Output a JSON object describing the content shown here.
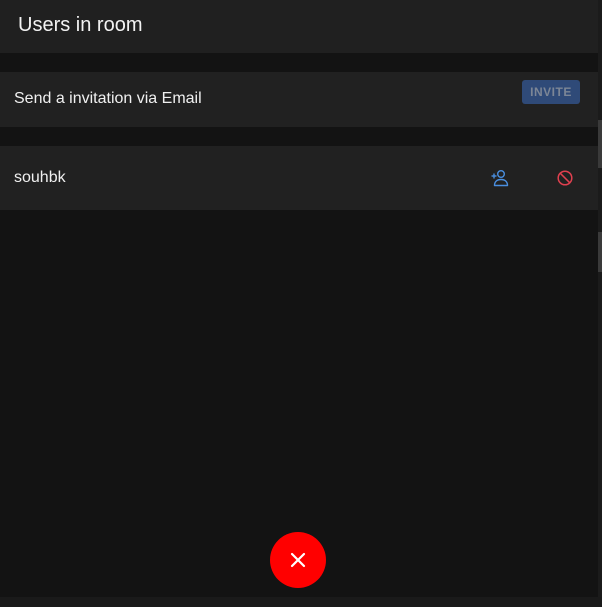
{
  "header": {
    "title": "Users in room"
  },
  "invite": {
    "label": "Send a invitation via Email",
    "button_label": "INVITE"
  },
  "users": [
    {
      "name": "souhbk",
      "actions": {
        "add_icon": "add-user-icon",
        "ban_icon": "ban-icon"
      }
    }
  ],
  "close_fab": {
    "icon": "close-icon"
  },
  "colors": {
    "accent_blue": "#4a8fe0",
    "danger_red": "#e0404f",
    "fab_red": "#ff0000",
    "invite_button_bg": "#2f4a78"
  }
}
